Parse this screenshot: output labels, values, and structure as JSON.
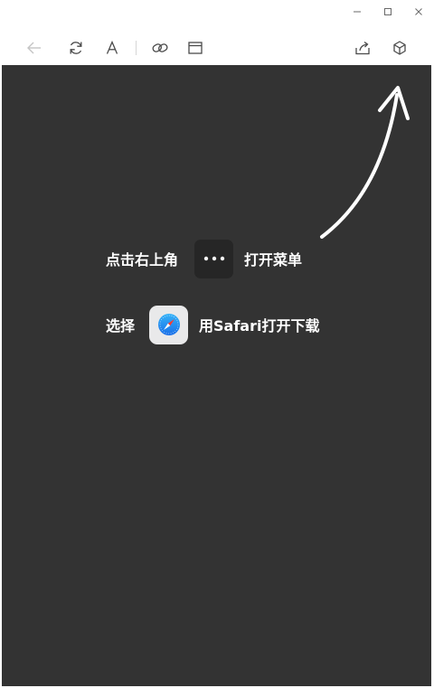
{
  "window": {
    "controls": [
      "minimize",
      "maximize",
      "close"
    ]
  },
  "toolbar": {
    "left_icons": [
      "back-arrow-icon",
      "refresh-icon",
      "font-icon",
      "link-icon",
      "window-icon"
    ],
    "right_icons": [
      "share-icon",
      "cube-icon"
    ]
  },
  "guide": {
    "step1_prefix": "点击右上角",
    "step1_icon": "more-dots-icon",
    "step1_suffix": "打开菜单",
    "step2_prefix": "选择",
    "step2_icon": "safari-icon",
    "step2_suffix": "用Safari打开下载"
  },
  "colors": {
    "overlay_background": "#333333",
    "tile_dark": "#262626",
    "text": "#ffffff",
    "safari_blue": "#1e8ef3"
  }
}
